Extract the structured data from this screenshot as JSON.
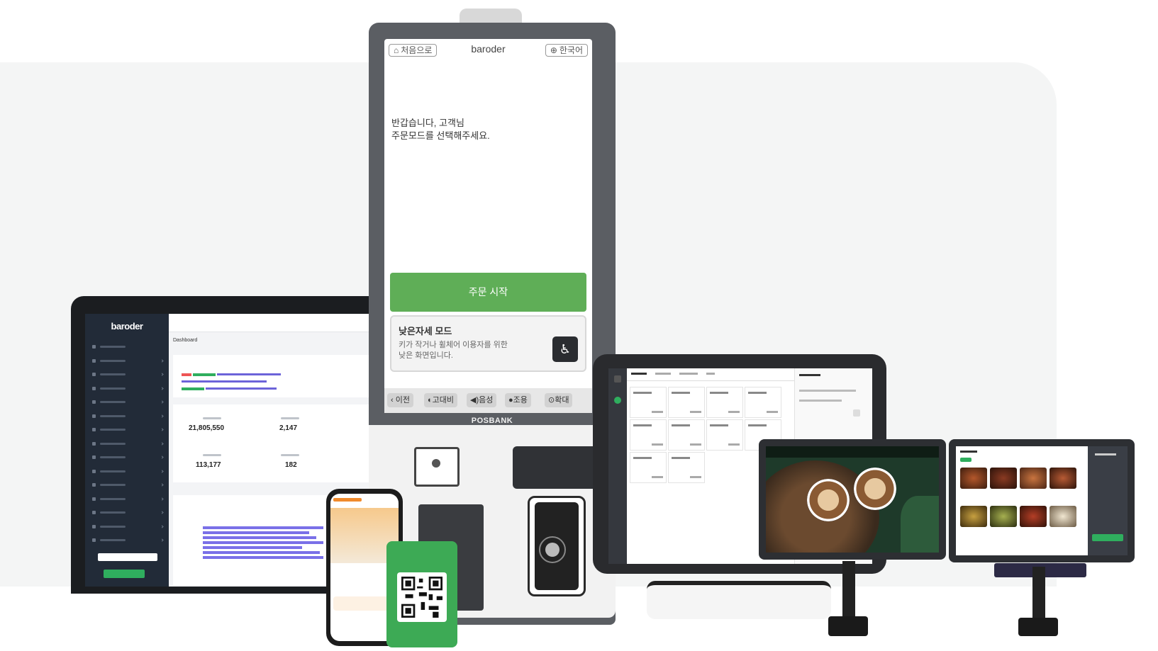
{
  "colors": {
    "kiosk_green": "#5fae57",
    "laptop_sidebar": "#222b38",
    "qr_green": "#3daa55",
    "chart_purple": "#7a70e8"
  },
  "kiosk": {
    "home_label": "처음으로",
    "brand": "baroder",
    "language_label": "한국어",
    "greeting_line1": "반갑습니다, 고객님",
    "greeting_line2": "주문모드를 선택해주세요.",
    "start_button": "주문 시작",
    "low_mode_title": "낮은자세 모드",
    "low_mode_desc_line1": "키가 작거나 휠체어 이용자를 위한",
    "low_mode_desc_line2": "낮은 화면입니다.",
    "bottom_buttons": [
      "이전",
      "고대비",
      "음성",
      "조용",
      "확대"
    ],
    "device_brand": "POSBANK"
  },
  "laptop": {
    "brand": "baroder",
    "page_title": "Dashboard",
    "stats": [
      "21,805,550",
      "2,147",
      "113,177",
      "182"
    ]
  }
}
